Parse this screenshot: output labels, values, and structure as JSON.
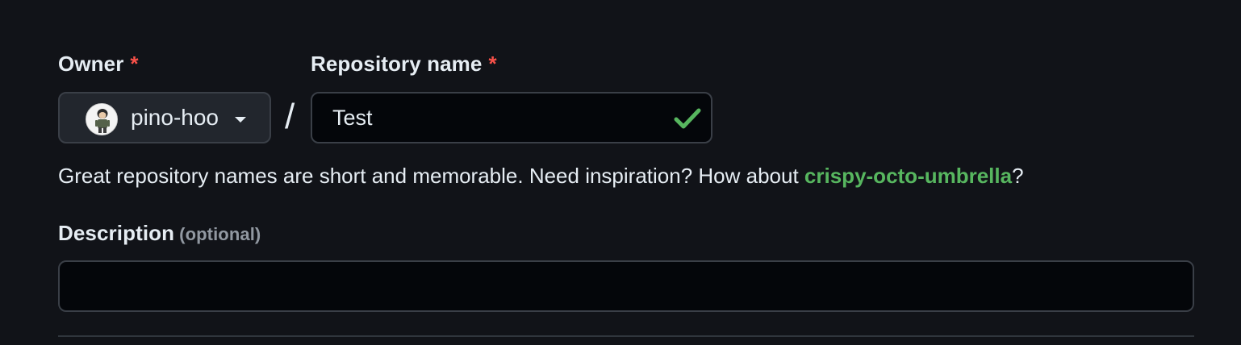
{
  "owner": {
    "label": "Owner",
    "required_mark": "*",
    "selected": "pino-hoo",
    "avatar_icon": "user-avatar",
    "dropdown_icon": "caret-down-icon"
  },
  "separator": "/",
  "repository_name": {
    "label": "Repository name",
    "required_mark": "*",
    "value": "Test",
    "status_icon": "check-icon",
    "status_color": "#57b65f"
  },
  "hint": {
    "prefix": "Great repository names are short and memorable. Need inspiration? How about ",
    "suggestion": "crispy-octo-umbrella",
    "suffix": "?"
  },
  "description": {
    "label": "Description",
    "optional_note": "(optional)",
    "value": "",
    "placeholder": ""
  },
  "colors": {
    "background": "#111318",
    "required": "#f85149",
    "accent": "#57b65f",
    "muted": "#9198a1"
  }
}
